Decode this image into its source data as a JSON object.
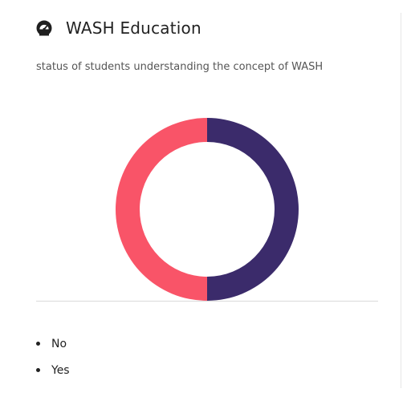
{
  "card": {
    "title": "WASH Education",
    "subtitle": "status of students understanding the concept of WASH",
    "icon": "dashboard-gauge-icon"
  },
  "chart_data": {
    "type": "pie",
    "donut": true,
    "categories": [
      "No",
      "Yes"
    ],
    "values": [
      50,
      50
    ],
    "colors": [
      "#f95468",
      "#3b2b6b"
    ],
    "legend_position": "bottom"
  },
  "legend": {
    "items": [
      {
        "label": "No"
      },
      {
        "label": "Yes"
      }
    ]
  }
}
